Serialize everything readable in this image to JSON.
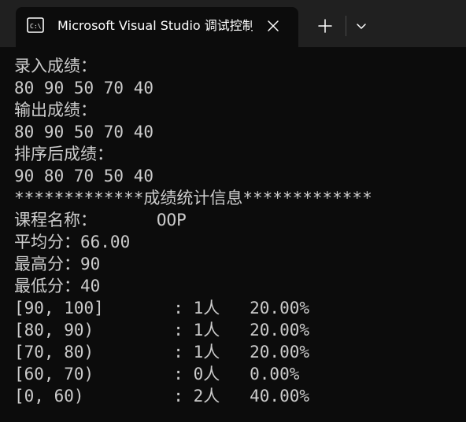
{
  "window": {
    "tab_title": "Microsoft Visual Studio 调试控制台",
    "tab_icon": "console-app-icon",
    "close_icon": "close-icon",
    "new_tab_icon": "plus-icon",
    "dropdown_icon": "chevron-down-icon"
  },
  "colors": {
    "titlebar_bg": "#202020",
    "console_bg": "#0c0c0c",
    "console_fg": "#cccccc"
  },
  "console": {
    "lines": [
      "录入成绩：",
      "80 90 50 70 40",
      "输出成绩：",
      "80 90 50 70 40",
      "排序后成绩：",
      "90 80 70 50 40",
      "*************成绩统计信息*************",
      "课程名称：      OOP",
      "平均分：66.00",
      "最高分：90",
      "最低分：40",
      "[90, 100]       : 1人   20.00%",
      "[80, 90)        : 1人   20.00%",
      "[70, 80)        : 1人   20.00%",
      "[60, 70)        : 0人   0.00%",
      "[0, 60)         : 2人   40.00%"
    ]
  }
}
